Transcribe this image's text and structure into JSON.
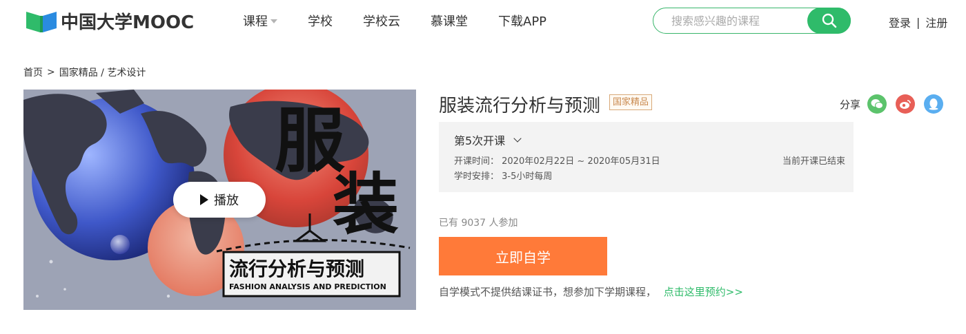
{
  "brand": {
    "logo_text": "中国大学MOOC",
    "accent": "#2fbb6a",
    "logo_blue": "#2a8be0"
  },
  "nav": {
    "items": [
      "课程",
      "学校",
      "学校云",
      "慕课堂",
      "下载APP"
    ]
  },
  "search": {
    "placeholder": "搜索感兴趣的课程",
    "value": ""
  },
  "auth": {
    "login": "登录",
    "register": "注册"
  },
  "breadcrumb": {
    "home": "首页",
    "sep": ">",
    "category": "国家精品 / 艺术设计"
  },
  "video": {
    "play_label": "播放",
    "poster_title": "服",
    "poster_title2": "装",
    "poster_subtitle": "流行分析与预测",
    "poster_english": "FASHION ANALYSIS AND PREDICTION"
  },
  "course": {
    "title": "服装流行分析与预测",
    "tag": "国家精品",
    "share_label": "分享",
    "share_icons": [
      "wechat-icon",
      "weibo-icon",
      "qq-icon"
    ],
    "term": {
      "label": "第5次开课",
      "time_line": "开课时间：  2020年02月22日 ~ 2020年05月31日",
      "hours_line": "学时安排：  3-5小时每周",
      "status": "当前开课已结束"
    },
    "joined": "已有 9037 人参加",
    "join_button": "立即自学",
    "note": "自学模式不提供结课证书，想参加下学期课程，",
    "note_link": "点击这里预约>>"
  }
}
